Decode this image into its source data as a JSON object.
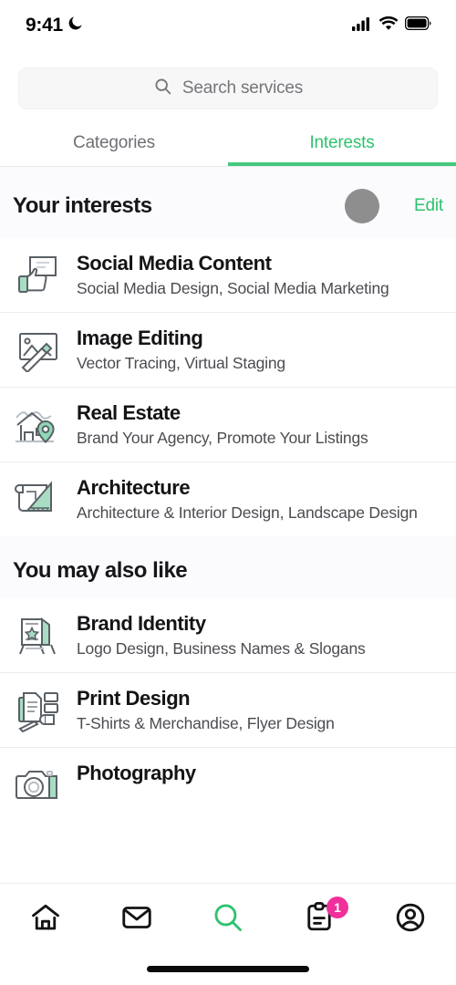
{
  "status_bar": {
    "time": "9:41",
    "dnd_icon": "moon-icon",
    "cellular_icon": "cellular-bars-icon",
    "wifi_icon": "wifi-icon",
    "battery_icon": "battery-full-icon"
  },
  "search": {
    "icon": "search-icon",
    "placeholder": "Search services",
    "value": ""
  },
  "tabs": [
    {
      "label": "Categories",
      "active": false
    },
    {
      "label": "Interests",
      "active": true
    }
  ],
  "accent_color": "#2ec26e",
  "underline_color": "#45c97f",
  "badge_color": "#f0309a",
  "sections": [
    {
      "title": "Your interests",
      "edit_label": "Edit",
      "has_cursor_dot": true,
      "items": [
        {
          "title": "Social Media Content",
          "subtitle": "Social Media Design, Social Media Marketing",
          "icon": "speech-bubble-thumbs-up-icon"
        },
        {
          "title": "Image Editing",
          "subtitle": "Vector Tracing, Virtual Staging",
          "icon": "photo-magic-wand-icon"
        },
        {
          "title": "Real Estate",
          "subtitle": "Brand Your Agency, Promote Your Listings",
          "icon": "house-map-pin-icon"
        },
        {
          "title": "Architecture",
          "subtitle": "Architecture & Interior Design, Landscape Design",
          "icon": "blueprint-set-square-icon"
        }
      ]
    },
    {
      "title": "You may also like",
      "edit_label": "",
      "has_cursor_dot": false,
      "items": [
        {
          "title": "Brand Identity",
          "subtitle": "Logo Design, Business Names & Slogans",
          "icon": "easel-star-sign-icon"
        },
        {
          "title": "Print Design",
          "subtitle": "T-Shirts & Merchandise, Flyer Design",
          "icon": "documents-pencil-icon"
        },
        {
          "title": "Photography",
          "subtitle": "",
          "icon": "camera-icon"
        }
      ]
    }
  ],
  "bottom_nav": [
    {
      "icon": "home-icon",
      "active": false,
      "badge": ""
    },
    {
      "icon": "envelope-icon",
      "active": false,
      "badge": ""
    },
    {
      "icon": "search-icon",
      "active": true,
      "badge": ""
    },
    {
      "icon": "clipboard-orders-icon",
      "active": false,
      "badge": "1"
    },
    {
      "icon": "account-circle-icon",
      "active": false,
      "badge": ""
    }
  ]
}
